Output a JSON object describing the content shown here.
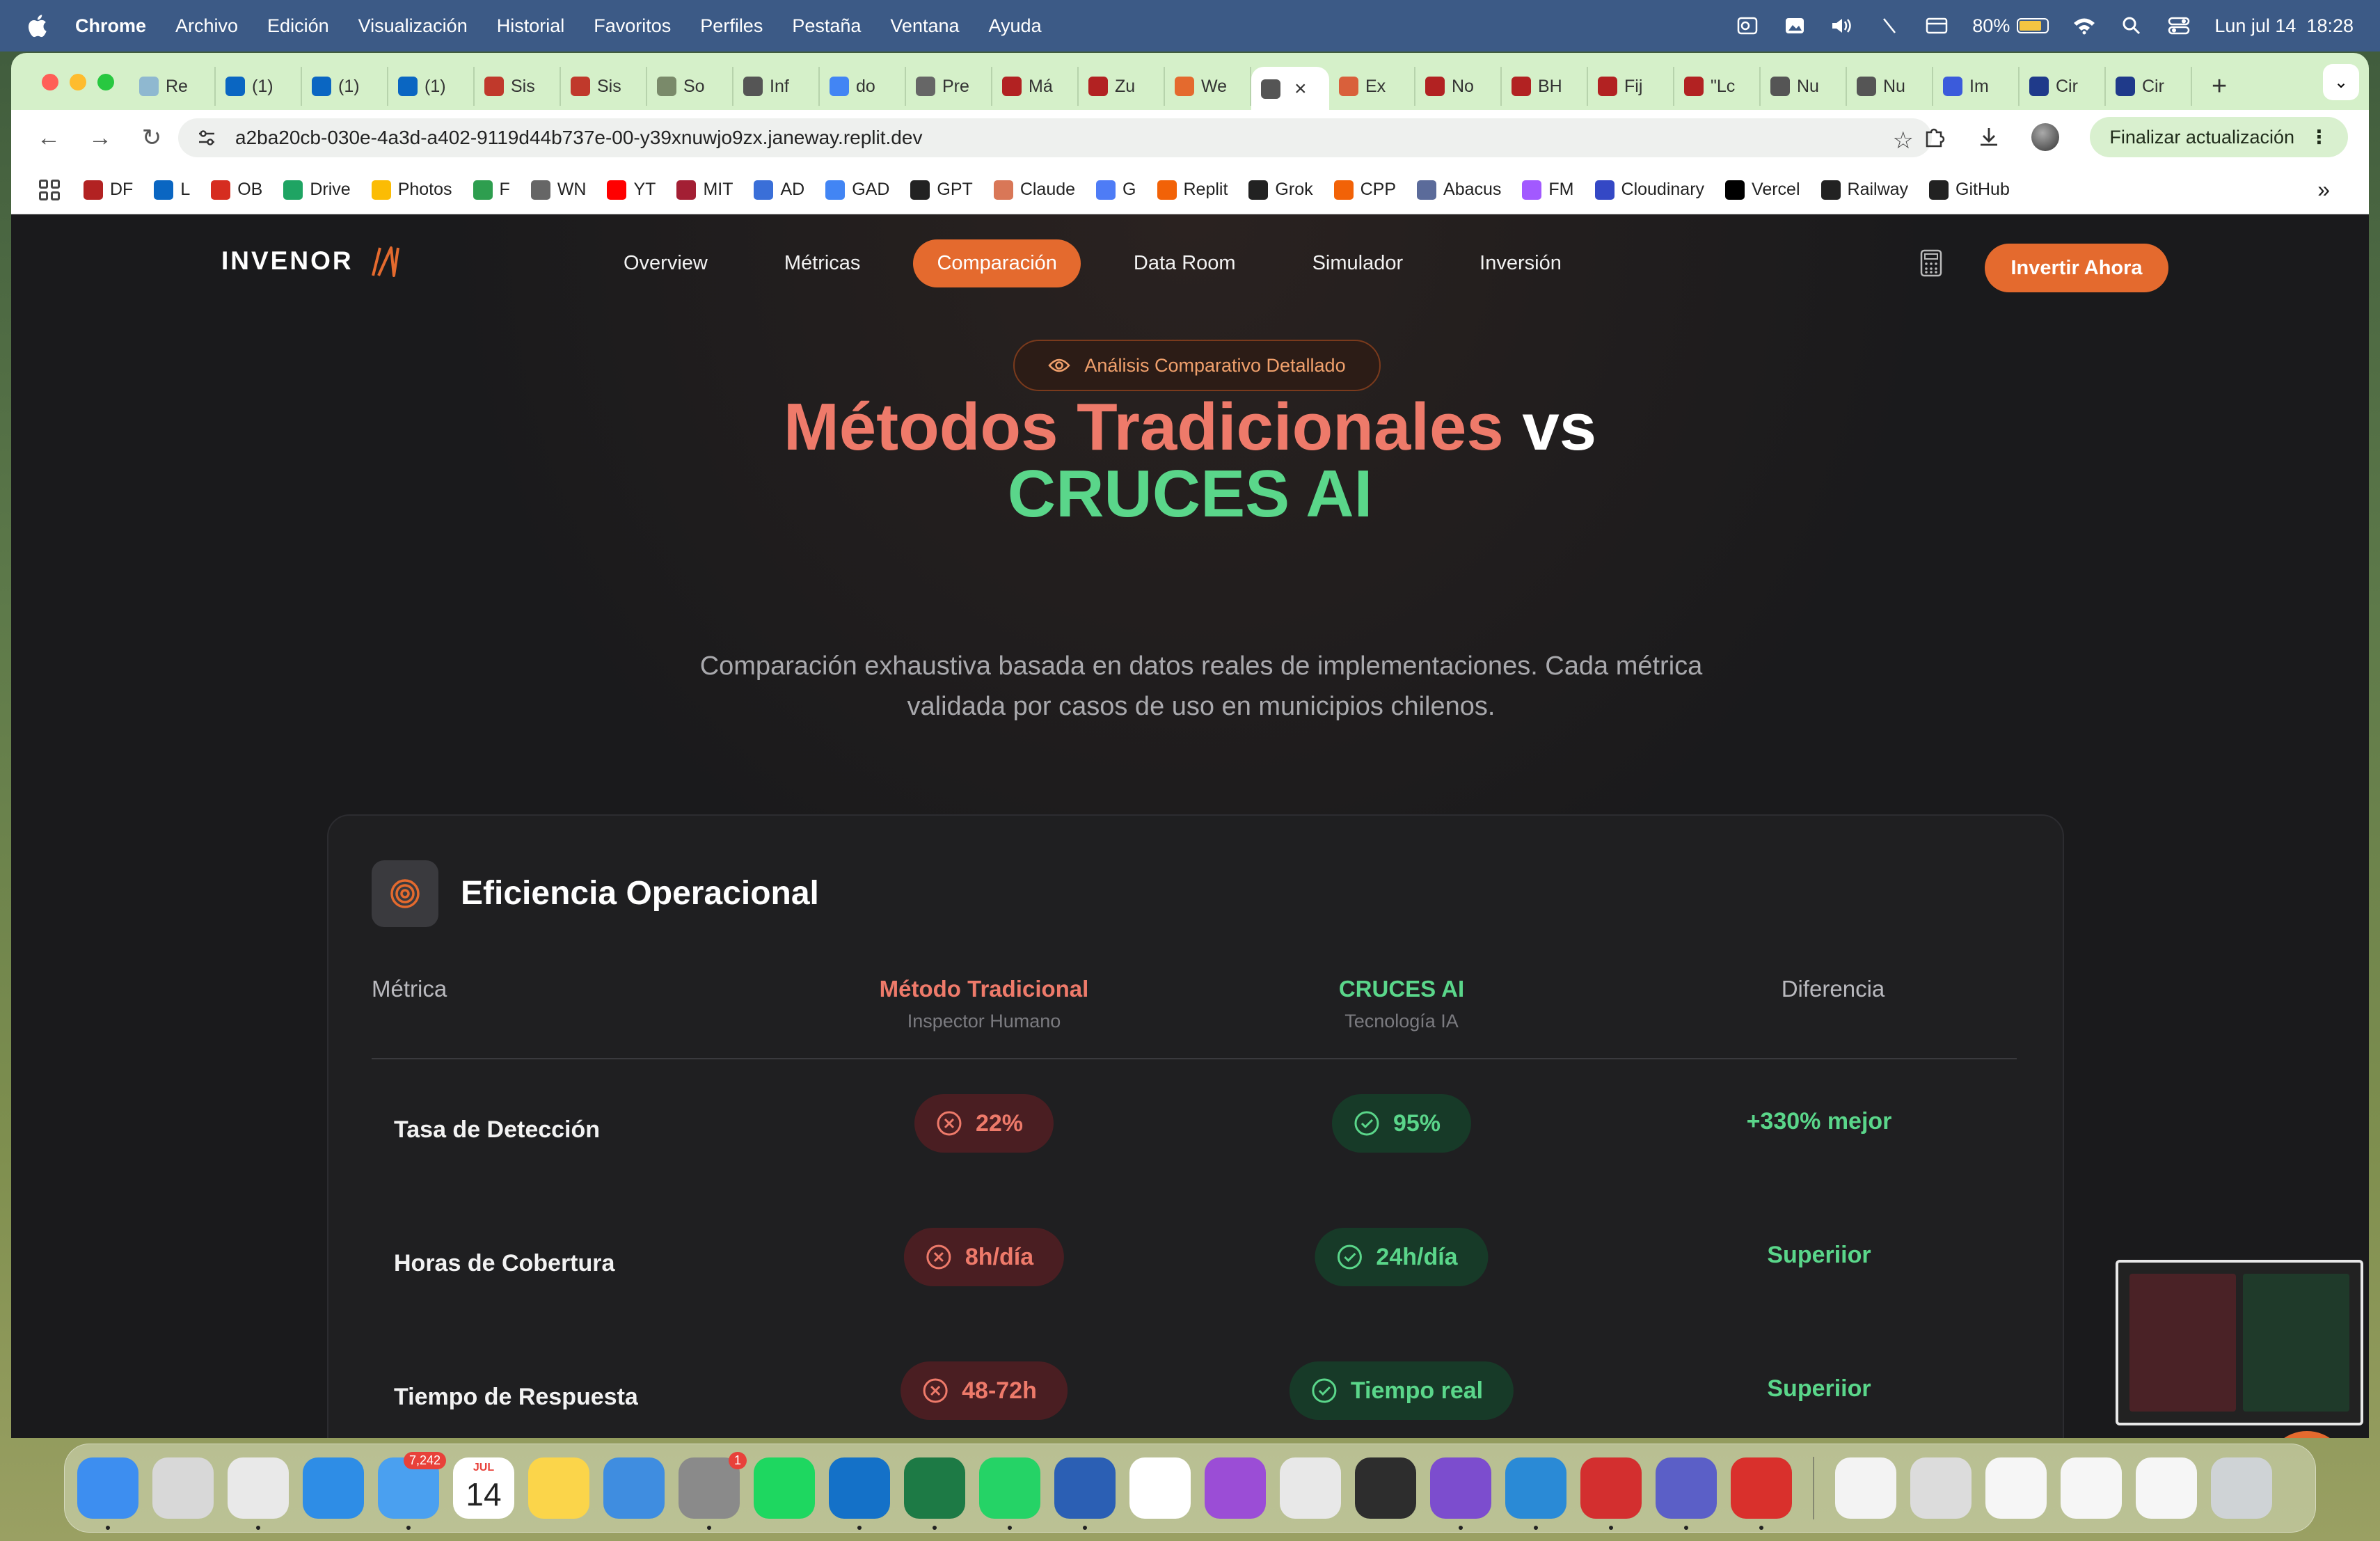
{
  "menubar": {
    "app_name": "Chrome",
    "menus": [
      "Archivo",
      "Edición",
      "Visualización",
      "Historial",
      "Favoritos",
      "Perfiles",
      "Pestaña",
      "Ventana",
      "Ayuda"
    ],
    "battery": "80%",
    "datetime": "Lun jul 14  18:28"
  },
  "tabs": [
    {
      "label": "Re",
      "color": "#8fb8d0"
    },
    {
      "label": "(1)",
      "color": "#0a66c2"
    },
    {
      "label": "(1)",
      "color": "#0a66c2"
    },
    {
      "label": "(1)",
      "color": "#0a66c2"
    },
    {
      "label": "Sis",
      "color": "#c0392b"
    },
    {
      "label": "Sis",
      "color": "#c0392b"
    },
    {
      "label": "So",
      "color": "#7a8a6a"
    },
    {
      "label": "Inf",
      "color": "#555555"
    },
    {
      "label": "do",
      "color": "#4285f4"
    },
    {
      "label": "Pre",
      "color": "#666666"
    },
    {
      "label": "Má",
      "color": "#b22222"
    },
    {
      "label": "Zu",
      "color": "#b22222"
    },
    {
      "label": "We",
      "color": "#e46a2e"
    },
    {
      "label": "",
      "color": "#555555",
      "active": true
    },
    {
      "label": "Ex",
      "color": "#d9603b"
    },
    {
      "label": "No",
      "color": "#b22222"
    },
    {
      "label": "BH",
      "color": "#b22222"
    },
    {
      "label": "Fij",
      "color": "#b22222"
    },
    {
      "label": "\"Lc",
      "color": "#b22222"
    },
    {
      "label": "Nu",
      "color": "#555555"
    },
    {
      "label": "Nu",
      "color": "#555555"
    },
    {
      "label": "Im",
      "color": "#3b5bdb"
    },
    {
      "label": "Cir",
      "color": "#1f3a8a"
    },
    {
      "label": "Cir",
      "color": "#1f3a8a"
    }
  ],
  "toolbar": {
    "url": "a2ba20cb-030e-4a3d-a402-9119d44b737e-00-y39xnuwjo9zx.janeway.replit.dev",
    "update_label": "Finalizar actualización"
  },
  "bookmarks": [
    {
      "label": "DF",
      "color": "#b22222"
    },
    {
      "label": "L",
      "color": "#0a66c2"
    },
    {
      "label": "OB",
      "color": "#d62d20"
    },
    {
      "label": "Drive",
      "color": "#1fa463"
    },
    {
      "label": "Photos",
      "color": "#fbbc04"
    },
    {
      "label": "F",
      "color": "#2e9e4f"
    },
    {
      "label": "WN",
      "color": "#666666"
    },
    {
      "label": "YT",
      "color": "#ff0000"
    },
    {
      "label": "MIT",
      "color": "#a31f34"
    },
    {
      "label": "AD",
      "color": "#3a6fd8"
    },
    {
      "label": "GAD",
      "color": "#4285f4"
    },
    {
      "label": "GPT",
      "color": "#222222"
    },
    {
      "label": "Claude",
      "color": "#d97757"
    },
    {
      "label": "G",
      "color": "#4e7cf6"
    },
    {
      "label": "Replit",
      "color": "#f26207"
    },
    {
      "label": "Grok",
      "color": "#222222"
    },
    {
      "label": "CPP",
      "color": "#f26207"
    },
    {
      "label": "Abacus",
      "color": "#5b6b9a"
    },
    {
      "label": "FM",
      "color": "#a259ff"
    },
    {
      "label": "Cloudinary",
      "color": "#3448c5"
    },
    {
      "label": "Vercel",
      "color": "#000000"
    },
    {
      "label": "Railway",
      "color": "#222222"
    },
    {
      "label": "GitHub",
      "color": "#222222"
    }
  ],
  "site": {
    "logo": "INVENOR",
    "nav": [
      "Overview",
      "Métricas",
      "Comparación",
      "Data Room",
      "Simulador",
      "Inversión"
    ],
    "active_nav": "Comparación",
    "cta": "Invertir Ahora",
    "accent": "#e46a2e"
  },
  "hero": {
    "badge": "Análisis Comparativo Detallado",
    "title_traditional": "Métodos Tradicionales",
    "title_vs": "vs",
    "title_ai": "CRUCES AI",
    "subtitle": "Comparación exhaustiva basada en datos reales de implementaciones. Cada métrica validada por casos de uso en municipios chilenos."
  },
  "card": {
    "title": "Eficiencia Operacional",
    "headers": {
      "metric": "Métrica",
      "traditional": "Método Tradicional",
      "traditional_sub": "Inspector Humano",
      "ai": "CRUCES AI",
      "ai_sub": "Tecnología IA",
      "difference": "Diferencia"
    },
    "rows": [
      {
        "metric": "Tasa de Detección",
        "traditional": "22%",
        "ai": "95%",
        "difference": "+330% mejor"
      },
      {
        "metric": "Horas de Cobertura",
        "traditional": "8h/día",
        "ai": "24h/día",
        "difference": "Superiior"
      },
      {
        "metric": "Tiempo de Respuesta",
        "traditional": "48-72h",
        "ai": "Tiempo real",
        "difference": "Superiior"
      }
    ]
  },
  "dock": {
    "apps": [
      {
        "name": "finder",
        "color": "#3d8ef0",
        "running": true
      },
      {
        "name": "launchpad",
        "color": "#d8d8d8",
        "running": false
      },
      {
        "name": "chrome",
        "color": "#e9e9e9",
        "running": true
      },
      {
        "name": "safari",
        "color": "#2e8de6",
        "running": false
      },
      {
        "name": "mail",
        "color": "#4aa0f0",
        "running": true,
        "badge": "7,242"
      },
      {
        "name": "calendar",
        "color": "#ffffff",
        "running": false,
        "month": "JUL",
        "day": "14"
      },
      {
        "name": "notes",
        "color": "#fbd54a",
        "running": false
      },
      {
        "name": "keynote",
        "color": "#3f8de0",
        "running": false
      },
      {
        "name": "settings",
        "color": "#8a8a8a",
        "running": true,
        "badge": "1"
      },
      {
        "name": "spotify",
        "color": "#1ed760",
        "running": false
      },
      {
        "name": "outlook",
        "color": "#1471c8",
        "running": true
      },
      {
        "name": "excel",
        "color": "#1d7a45",
        "running": true
      },
      {
        "name": "whatsapp",
        "color": "#25d366",
        "running": true
      },
      {
        "name": "word",
        "color": "#2b5fb4",
        "running": true
      },
      {
        "name": "calendar-31",
        "color": "#ffffff",
        "running": false
      },
      {
        "name": "circle-app",
        "color": "#9b4dd6",
        "running": false
      },
      {
        "name": "iphone-mirroring",
        "color": "#e8e8e8",
        "running": false
      },
      {
        "name": "setapp",
        "color": "#2d2d2d",
        "running": false
      },
      {
        "name": "github-desktop",
        "color": "#7c4dce",
        "running": true
      },
      {
        "name": "vscode",
        "color": "#2a8ad6",
        "running": true
      },
      {
        "name": "acrobat",
        "color": "#d32f2f",
        "running": true
      },
      {
        "name": "teams",
        "color": "#5b5fc7",
        "running": true
      },
      {
        "name": "photo-booth",
        "color": "#d9302c",
        "running": true
      }
    ],
    "recent": [
      {
        "name": "invenor-doc",
        "color": "#f3f3f3"
      },
      {
        "name": "screenshot-1",
        "color": "#dcdcdc"
      },
      {
        "name": "word-doc-1",
        "color": "#f6f6f6"
      },
      {
        "name": "word-doc-2",
        "color": "#f6f6f6"
      },
      {
        "name": "excel-doc",
        "color": "#f6f6f6"
      },
      {
        "name": "trash",
        "color": "#cfd3d6"
      }
    ]
  }
}
